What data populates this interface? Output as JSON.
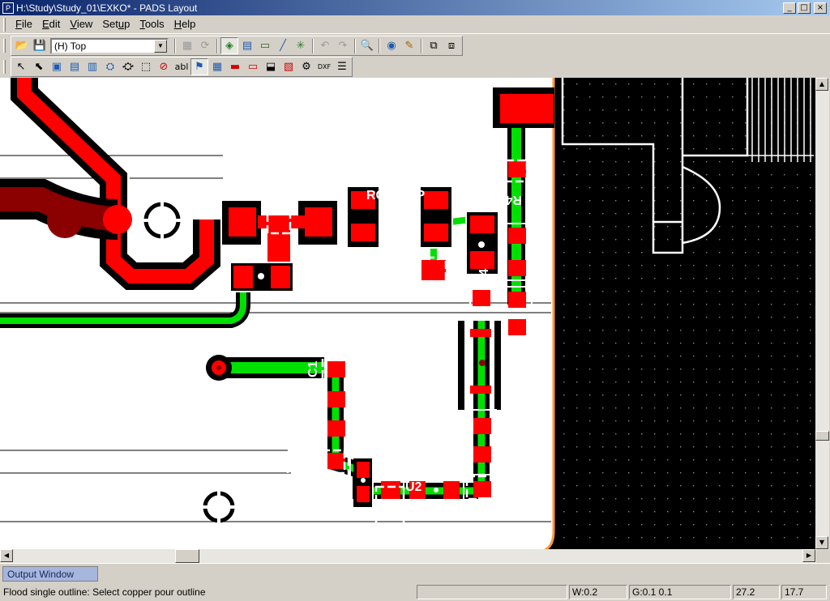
{
  "window": {
    "title": "H:\\Study\\Study_01\\EXKO* - PADS Layout",
    "app_icon": "pads-app-icon",
    "controls": {
      "minimize": "_",
      "maximize": "□",
      "close": "×"
    }
  },
  "menu": [
    {
      "pre": "",
      "acc": "F",
      "post": "ile"
    },
    {
      "pre": "",
      "acc": "E",
      "post": "dit"
    },
    {
      "pre": "",
      "acc": "V",
      "post": "iew"
    },
    {
      "pre": "Set",
      "acc": "u",
      "post": "p"
    },
    {
      "pre": "",
      "acc": "T",
      "post": "ools"
    },
    {
      "pre": "",
      "acc": "H",
      "post": "elp"
    }
  ],
  "toolbar": {
    "layer_select": {
      "value": "(H) Top"
    },
    "icons": {
      "open": "📂",
      "save": "💾",
      "props": "▦",
      "refresh": "⟳",
      "layers": "◈",
      "pour": "▤",
      "board": "▭",
      "route": "╱",
      "star": "✳",
      "undo": "↶",
      "redo": "↷",
      "find": "🔍",
      "view": "◉",
      "paint": "✎",
      "zoom1": "⧉",
      "zoom2": "⧈"
    }
  },
  "drafting_toolbar": {
    "icons": {
      "select": "↖",
      "select2": "⬉",
      "copper": "▣",
      "copper_cutout": "▤",
      "copper_pour": "▥",
      "hatch": "⛭",
      "hatch2": "⛮",
      "board_outline": "⬚",
      "keepout": "⊘",
      "text": "abl",
      "flood": "⚑",
      "pour_manager": "▦",
      "dim": "▬",
      "dim2": "▭",
      "import": "⬓",
      "from_lib": "▧",
      "tree": "⚙",
      "dxf": "DXF",
      "list": "☰"
    }
  },
  "canvas": {
    "component_labels": {
      "r4": "R4",
      "c1": "C1",
      "u2": "U2",
      "c4": "C4",
      "rc": "RC",
      "cp": "CP"
    }
  },
  "output_window": {
    "tab_label": "Output Window"
  },
  "status": {
    "message": "Flood single outline: Select copper pour outline",
    "width": "W:0.2",
    "grid": "G:0.1 0.1",
    "x": "27.2",
    "y": "17.7"
  },
  "colors": {
    "copper_top": "#ff0000",
    "trace_selected": "#00ff00",
    "board_bg": "#000000",
    "highlight": "#ffffff",
    "outline_orange": "#ff9933"
  }
}
